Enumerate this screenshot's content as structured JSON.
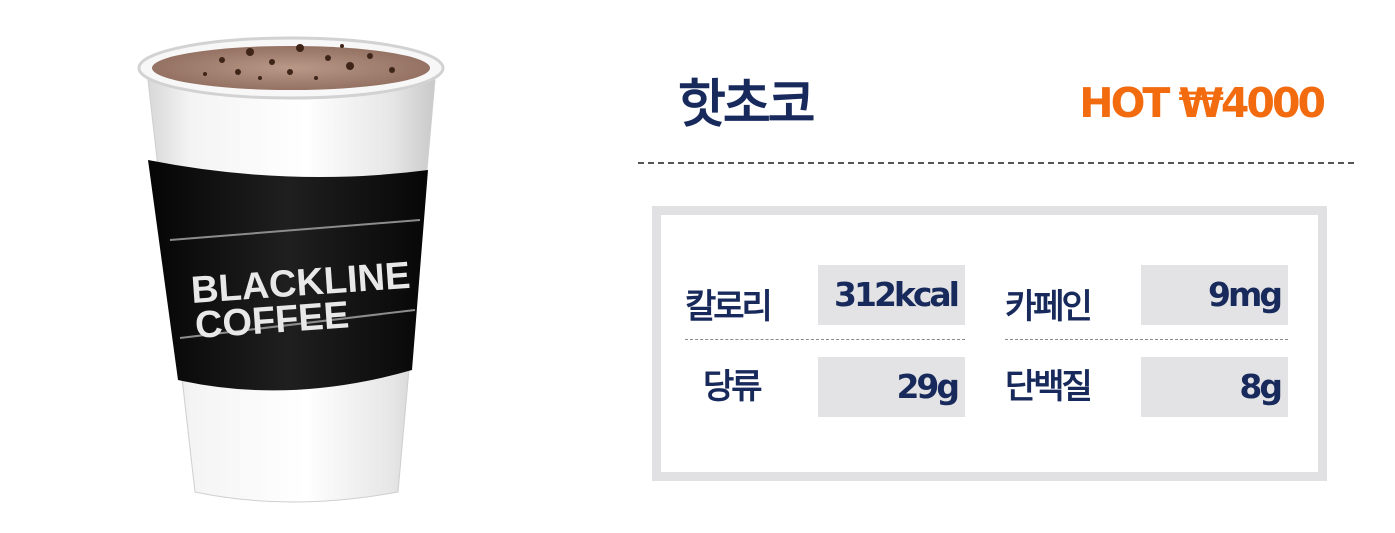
{
  "product": {
    "name": "핫초코",
    "price_label": "HOT ₩4000",
    "image": {
      "sleeve_text_line1": "BLACKLINE",
      "sleeve_text_line2": "COFFEE"
    }
  },
  "nutrition": {
    "calories": {
      "label": "칼로리",
      "value": "312kcal"
    },
    "caffeine": {
      "label": "카페인",
      "value": "9mg"
    },
    "sugar": {
      "label": "당류",
      "value": "29g"
    },
    "protein": {
      "label": "단백질",
      "value": "8g"
    }
  },
  "colors": {
    "title": "#182a5c",
    "price": "#f26b0f",
    "panel_border": "#e1e1e3",
    "value_box": "#e3e3e5"
  }
}
